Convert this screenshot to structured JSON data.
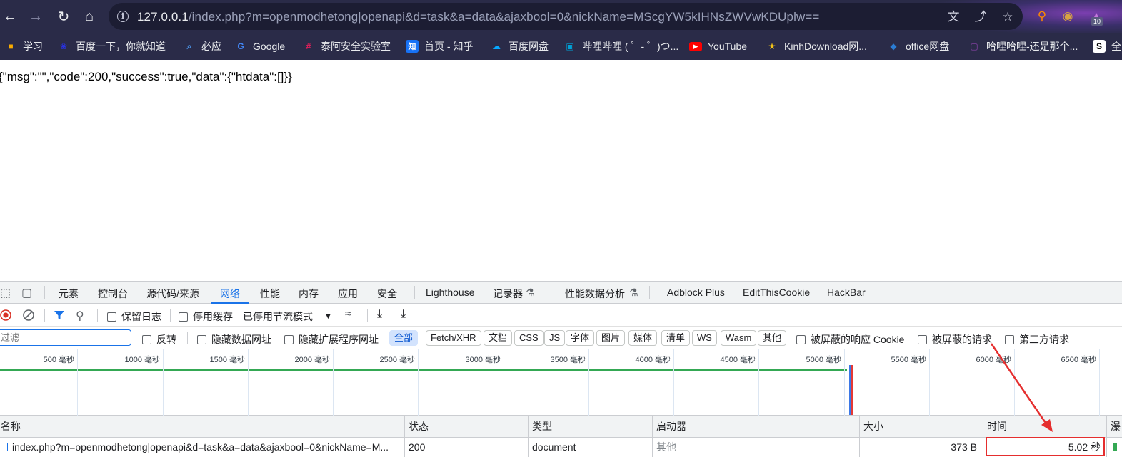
{
  "browser": {
    "url_host": "127.0.0.1",
    "url_rest": "/index.php?m=openmodhetong|openapi&d=task&a=data&ajaxbool=0&nickName=MScgYW5kIHNsZWVwKDUplw==",
    "extension_badge": "10"
  },
  "bookmarks": [
    {
      "label": "学习",
      "icon": "folder-icon",
      "color": "#f9ab00"
    },
    {
      "label": "百度一下，你就知道",
      "icon": "baidu-icon",
      "color": "#2932e1"
    },
    {
      "label": "必应",
      "icon": "bing-icon",
      "color": "#4a90e2"
    },
    {
      "label": "Google",
      "icon": "google-icon",
      "color": "#4285f4"
    },
    {
      "label": "泰阿安全实验室",
      "icon": "slack-icon",
      "color": "#e01e5a"
    },
    {
      "label": "首页 - 知乎",
      "icon": "zhihu-icon",
      "color": "#1772f6"
    },
    {
      "label": "百度网盘",
      "icon": "baidu-netdisk-icon",
      "color": "#06a7ff"
    },
    {
      "label": "哔哩哔哩 ( ゜- ゜)つ...",
      "icon": "bilibili-icon",
      "color": "#00a1d6"
    },
    {
      "label": "YouTube",
      "icon": "youtube-icon",
      "color": "#ff0000"
    },
    {
      "label": "KinhDownload网...",
      "icon": "kinh-icon",
      "color": "#f5c518"
    },
    {
      "label": "office网盘",
      "icon": "office-icon",
      "color": "#2b7cd3"
    },
    {
      "label": "哈哩哈哩-还是那个...",
      "icon": "halihali-icon",
      "color": "#8e44ad"
    },
    {
      "label": "全",
      "icon": "s-icon",
      "color": "#000000"
    }
  ],
  "page": {
    "json_response": "{\"msg\":\"\",\"code\":200,\"success\":true,\"data\":{\"htdata\":[]}}"
  },
  "devtools": {
    "tabs": [
      "元素",
      "控制台",
      "源代码/来源",
      "网络",
      "性能",
      "内存",
      "应用",
      "安全",
      "Lighthouse",
      "记录器",
      "性能数据分析",
      "Adblock Plus",
      "EditThisCookie",
      "HackBar"
    ],
    "active_tab": "网络",
    "toolbar": {
      "preserve_log": "保留日志",
      "disable_cache": "停用缓存",
      "throttling": "已停用节流模式"
    },
    "filter": {
      "placeholder": "过滤",
      "invert": "反转",
      "hide_data_urls": "隐藏数据网址",
      "hide_extension_urls": "隐藏扩展程序网址",
      "types": [
        "全部",
        "Fetch/XHR",
        "文档",
        "CSS",
        "JS",
        "字体",
        "图片",
        "媒体",
        "清单",
        "WS",
        "Wasm",
        "其他"
      ],
      "active_type": "全部",
      "blocked_cookies": "被屏蔽的响应 Cookie",
      "blocked_requests": "被屏蔽的请求",
      "third_party": "第三方请求"
    },
    "timeline": {
      "ticks": [
        "500 毫秒",
        "1000 毫秒",
        "1500 毫秒",
        "2000 毫秒",
        "2500 毫秒",
        "3000 毫秒",
        "3500 毫秒",
        "4000 毫秒",
        "4500 毫秒",
        "5000 毫秒",
        "5500 毫秒",
        "6000 毫秒",
        "6500 毫秒"
      ],
      "progress_ms": 5020
    },
    "columns": [
      "名称",
      "状态",
      "类型",
      "启动器",
      "大小",
      "时间",
      "瀑"
    ],
    "requests": [
      {
        "name": "index.php?m=openmodhetong|openapi&d=task&a=data&ajaxbool=0&nickName=M...",
        "status": "200",
        "type": "document",
        "initiator": "其他",
        "size": "373 B",
        "time": "5.02 秒"
      }
    ],
    "annotation_color": "#e52e2e"
  }
}
